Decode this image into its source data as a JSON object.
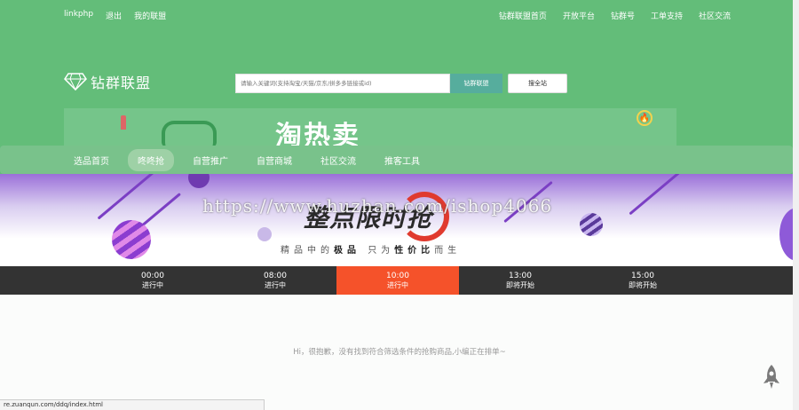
{
  "topbar": {
    "left_links": [
      "linkphp",
      "退出",
      "我的联盟"
    ],
    "right_links": [
      "钻群联盟首页",
      "开放平台",
      "钻群号",
      "工单支持",
      "社区交流"
    ]
  },
  "logo": {
    "brand": "钻群联盟",
    "icon": "diamond-icon"
  },
  "search": {
    "placeholder": "请输入关键词(支持淘宝/天猫/京东/拼多多链接或id)",
    "button_label": "钻群联盟",
    "all_button_label": "搜全站"
  },
  "promo": {
    "title": "淘热卖"
  },
  "nav": {
    "items": [
      {
        "label": "选品首页",
        "active": false
      },
      {
        "label": "咚咚抢",
        "active": true
      },
      {
        "label": "自营推广",
        "active": false
      },
      {
        "label": "自营商城",
        "active": false
      },
      {
        "label": "社区交流",
        "active": false
      },
      {
        "label": "推客工具",
        "active": false
      }
    ]
  },
  "hero": {
    "title": "整点限时抢",
    "subtitle_parts": [
      "精品中的",
      "极品",
      "只为",
      "性价比",
      "而生"
    ],
    "watermark": "https://www.huzhan.com/ishop4066"
  },
  "slots": [
    {
      "time": "00:00",
      "state": "进行中",
      "active": false
    },
    {
      "time": "08:00",
      "state": "进行中",
      "active": false
    },
    {
      "time": "10:00",
      "state": "进行中",
      "active": true
    },
    {
      "time": "13:00",
      "state": "即将开始",
      "active": false
    },
    {
      "time": "15:00",
      "state": "即将开始",
      "active": false
    }
  ],
  "empty_message": "Hi，很抱歉，没有找到符合筛选条件的抢购商品,小编正在排单~",
  "status_url": "re.zuanqun.com/ddq/index.html",
  "colors": {
    "header_green": "#63bd79",
    "active_slot": "#f5522a",
    "slot_bar": "#333333",
    "search_btn": "#56ad9d"
  }
}
